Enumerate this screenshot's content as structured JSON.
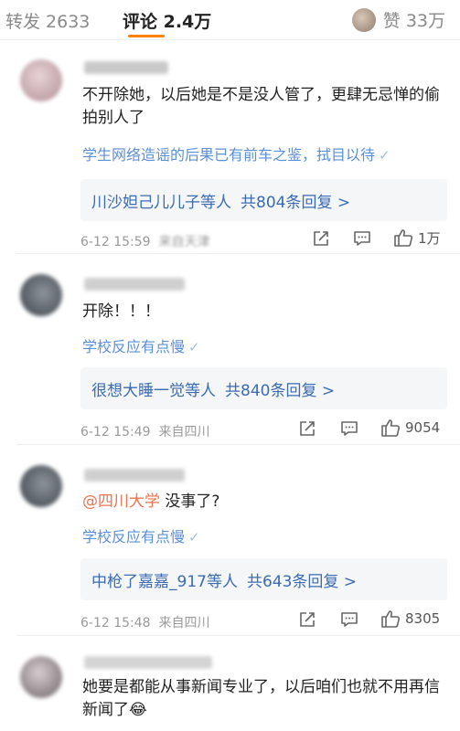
{
  "tabs": {
    "repost": "转发 2633",
    "comment": "评论 2.4万",
    "like": "赞 33万"
  },
  "comments": [
    {
      "text": "不开除她，以后她是不是没人管了，更肆无忌惮的偷拍别人了",
      "tag": "学生网络造谣的后果已有前车之鉴，拭目以待",
      "replies_users": "川沙妲己儿儿子等人",
      "replies_count": "共804条回复 >",
      "time": "6-12 15:59",
      "location": "来自天津",
      "likes": "1万"
    },
    {
      "text": "开除！！！",
      "tag": "学校反应有点慢",
      "replies_users": "很想大睡一觉等人",
      "replies_count": "共840条回复 >",
      "time": "6-12 15:49",
      "location": "来自四川",
      "likes": "9054"
    },
    {
      "mention": "@四川大学",
      "text": " 没事了?",
      "tag": "学校反应有点慢",
      "replies_users": "中枪了嘉嘉_917等人",
      "replies_count": "共643条回复 >",
      "time": "6-12 15:48",
      "location": "来自四川",
      "likes": "8305"
    },
    {
      "text": "她要是都能从事新闻专业了，以后咱们也就不用再信新闻了😂"
    }
  ],
  "colors": {
    "accent": "#ff8200",
    "link": "#3a6bb3",
    "tag": "#5b8fd6",
    "mention": "#eb7350"
  },
  "icons": [
    "share-icon",
    "comment-icon",
    "thumbs-up-icon",
    "check-chevron-icon"
  ]
}
